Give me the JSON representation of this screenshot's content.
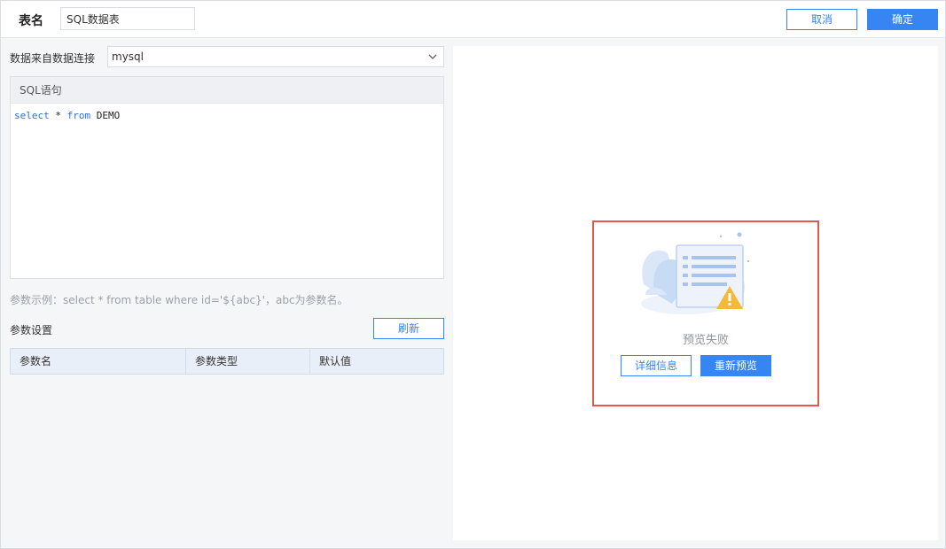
{
  "header": {
    "table_name_label": "表名",
    "table_name_value": "SQL数据表",
    "cancel_label": "取消",
    "ok_label": "确定"
  },
  "connection": {
    "label": "数据来自数据连接",
    "selected": "mysql"
  },
  "sql": {
    "title": "SQL语句",
    "tokens": [
      {
        "text": "select",
        "kind": "kw"
      },
      {
        "text": " * ",
        "kind": "tx"
      },
      {
        "text": "from",
        "kind": "kw"
      },
      {
        "text": " DEMO",
        "kind": "tx"
      }
    ]
  },
  "params": {
    "hint": "参数示例：select * from table where id='${abc}'，abc为参数名。",
    "settings_label": "参数设置",
    "refresh_label": "刷新",
    "columns": [
      "参数名",
      "参数类型",
      "默认值"
    ]
  },
  "preview": {
    "fail_text": "预览失败",
    "detail_label": "详细信息",
    "repreview_label": "重新预览"
  },
  "colors": {
    "accent": "#3685f2",
    "error_border": "#e05a4a",
    "warning": "#f5b93a"
  }
}
